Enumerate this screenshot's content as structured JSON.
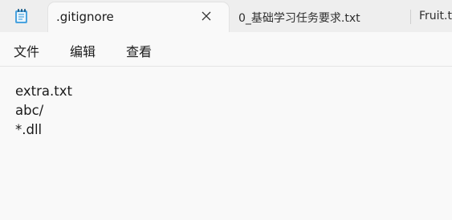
{
  "tabs": {
    "active": {
      "title": ".gitignore"
    },
    "others": [
      {
        "title": "0_基础学习任务要求.txt"
      },
      {
        "title": "Fruit.t"
      }
    ]
  },
  "menu": {
    "items": [
      "文件",
      "编辑",
      "查看"
    ]
  },
  "editor": {
    "lines": [
      "extra.txt",
      "abc/",
      "*.dll"
    ]
  }
}
